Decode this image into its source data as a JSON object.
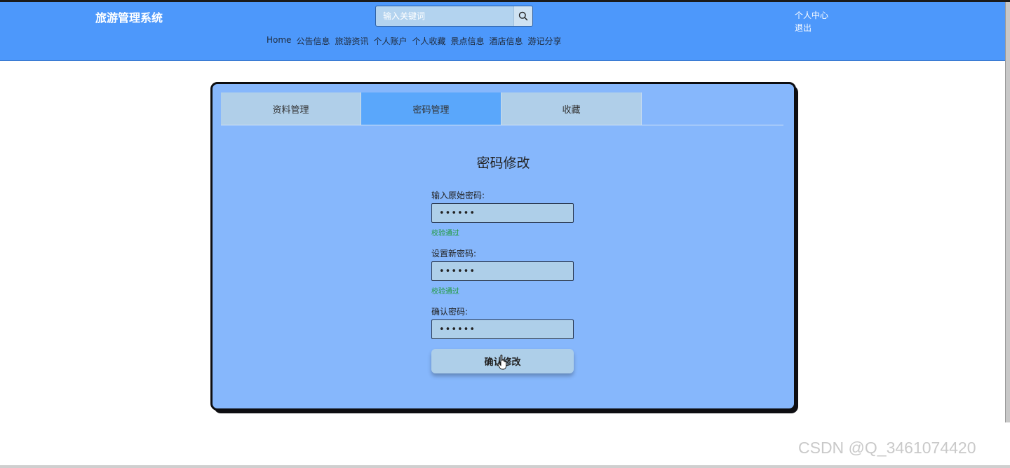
{
  "header": {
    "brand": "旅游管理系统",
    "search_placeholder": "输入关键词",
    "nav": [
      "Home",
      "公告信息",
      "旅游资讯",
      "个人账户",
      "个人收藏",
      "景点信息",
      "酒店信息",
      "游记分享"
    ],
    "user_center": "个人中心",
    "logout": "退出"
  },
  "tabs": [
    {
      "label": "资料管理",
      "active": false
    },
    {
      "label": "密码管理",
      "active": true
    },
    {
      "label": "收藏",
      "active": false
    }
  ],
  "form": {
    "title": "密码修改",
    "old_password_label": "输入原始密码:",
    "old_password_value": "••••••",
    "old_password_status": "校验通过",
    "new_password_label": "设置新密码:",
    "new_password_value": "••••••",
    "new_password_status": "校验通过",
    "confirm_password_label": "确认密码:",
    "confirm_password_value": "••••••",
    "submit_label": "确认修改"
  },
  "watermark": "CSDN @Q_3461074420",
  "colors": {
    "header_bg": "#4d98fb",
    "card_bg": "#86b7fc",
    "active_tab": "#5aa7fb",
    "valid_text": "#1f9a3a"
  },
  "icons": {
    "search": "search-icon",
    "cursor": "hand-cursor-icon"
  }
}
